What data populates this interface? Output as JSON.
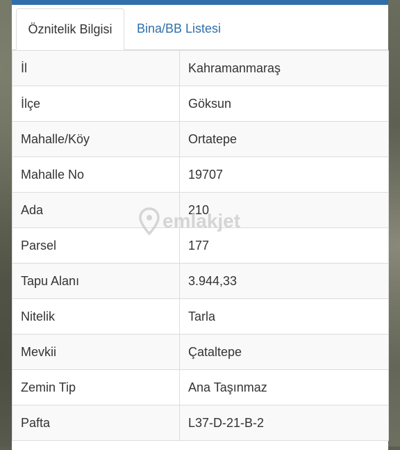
{
  "tabs": [
    {
      "label": "Öznitelik Bilgisi",
      "active": true
    },
    {
      "label": "Bina/BB Listesi",
      "active": false
    }
  ],
  "rows": [
    {
      "key": "İl",
      "value": "Kahramanmaraş"
    },
    {
      "key": "İlçe",
      "value": "Göksun"
    },
    {
      "key": "Mahalle/Köy",
      "value": "Ortatepe"
    },
    {
      "key": "Mahalle No",
      "value": "19707"
    },
    {
      "key": "Ada",
      "value": "210"
    },
    {
      "key": "Parsel",
      "value": "177"
    },
    {
      "key": "Tapu Alanı",
      "value": "3.944,33"
    },
    {
      "key": "Nitelik",
      "value": "Tarla"
    },
    {
      "key": "Mevkii",
      "value": "Çataltepe"
    },
    {
      "key": "Zemin Tip",
      "value": "Ana Taşınmaz"
    },
    {
      "key": "Pafta",
      "value": "L37-D-21-B-2"
    }
  ],
  "watermark": {
    "text": "emlakjet",
    "icon": "location-pin-icon"
  },
  "colors": {
    "accent": "#2f6fab",
    "text": "#333333",
    "border": "#dcdcdc"
  }
}
